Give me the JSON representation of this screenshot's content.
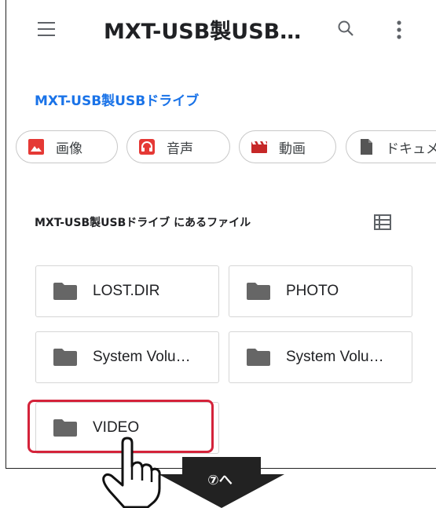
{
  "appbar": {
    "title": "MXT-USB製USB…"
  },
  "breadcrumb": "MXT-USB製USBドライブ",
  "chips": [
    {
      "label": "画像",
      "icon": "image-icon",
      "color": "#e53935"
    },
    {
      "label": "音声",
      "icon": "headphones-icon",
      "color": "#e53935"
    },
    {
      "label": "動画",
      "icon": "movie-clapper-icon",
      "color": "#c62828"
    },
    {
      "label": "ドキュメ",
      "icon": "document-icon",
      "color": "#555555"
    }
  ],
  "section_title": "MXT-USB製USBドライブ にあるファイル",
  "folders": [
    {
      "name": "LOST.DIR"
    },
    {
      "name": "PHOTO"
    },
    {
      "name": "System Volu…"
    },
    {
      "name": "System Volu…"
    },
    {
      "name": "VIDEO"
    }
  ],
  "callout": {
    "label": "⑦へ",
    "highlight_color": "#d4233a",
    "arrow_color": "#222222"
  },
  "colors": {
    "accent": "#1a73e8",
    "icon_gray": "#5f6368",
    "folder_gray": "#666666"
  }
}
